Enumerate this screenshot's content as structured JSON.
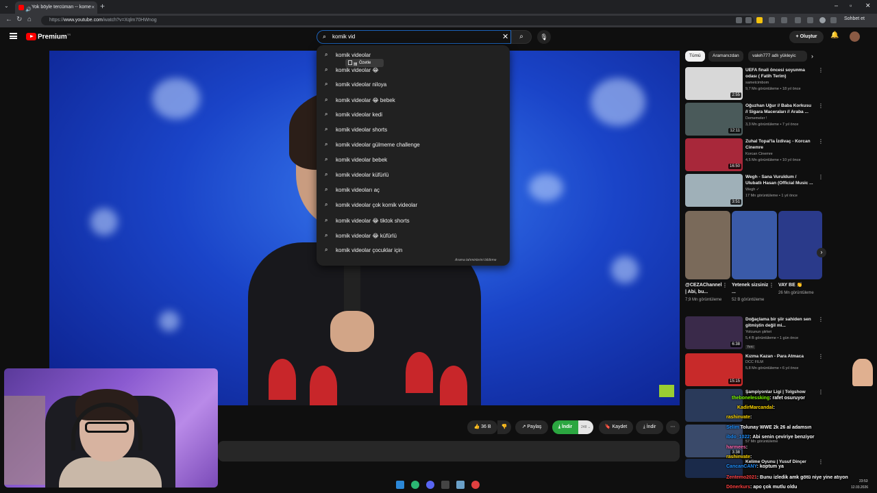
{
  "browser": {
    "tab_title": "Yok böyle tercüman -- kome",
    "url_prefix": "https://",
    "url_domain": "www.youtube.com",
    "url_path": "/watch?v=Xqlm70HWnog",
    "chat_button": "Sohbet et"
  },
  "youtube": {
    "logo_text": "Premium",
    "logo_sup": "TR",
    "search_value": "komik vid",
    "create_label": "Oluştur"
  },
  "suggestions": {
    "items": [
      "komik videolar",
      "komik videolar 😂",
      "komik videolar niloya",
      "komik videolar 😂 bebek",
      "komik videolar kedi",
      "komik videolar shorts",
      "komik videolar gülmeme challenge",
      "komik videolar bebek",
      "komik videolar küfürlü",
      "komik videoları aç",
      "komik videolar çok komik videolar",
      "komik videolar 😂 tiktok shorts",
      "komik videolar 😂 küfürlü",
      "komik videolar çocuklar için"
    ],
    "summarize_label": "Özetle",
    "footer": "Arama tahminlerini bildirme"
  },
  "actions": {
    "likes": "36 B",
    "share": "Paylaş",
    "join": "İndir",
    "join_count": "248",
    "save": "Kaydet",
    "download": "İndir"
  },
  "filters": [
    "Tümü",
    "Aramanızdan",
    "valeh777 adlı yükleyic"
  ],
  "related": [
    {
      "title": "UEFA finali öncesi soyunma odası ( Fatih Terim)",
      "channel": "sametcimbom",
      "meta": "9,7 Mn görüntüleme • 18 yıl önce",
      "duration": "2:55",
      "color": "#c8c8c8"
    },
    {
      "title": "Oğuzhan Uğur // Baba Korkusu // Sigara Maceraları // Araba ...",
      "channel": "Dememeler !",
      "meta": "3,3 Mn görüntüleme • 7 yıl önce",
      "duration": "12:11",
      "color": "#4a5a5a"
    },
    {
      "title": "Zuhal Topal'la İzdivaç - Korcan Cinemre",
      "channel": "Korcan Cinemre",
      "meta": "4,5 Mn görüntüleme • 10 yıl önce",
      "duration": "16:50",
      "color": "#a8283a"
    },
    {
      "title": "Wegh - Sana Vuruldum / Ulubatlı Hasan (Official Music ...",
      "channel": "Wegh ✓",
      "meta": "17 Mn görüntüleme • 1 yıl önce",
      "duration": "3:51",
      "color": "#9fb0b8"
    },
    {
      "title": "Doğaçlama bir şiir sahiden sen gitmiştin değil mi...",
      "channel": "Yolcunun şiirleri",
      "meta": "5,4 B görüntüleme • 1 gün önce",
      "duration": "6:38",
      "color": "#3a2a4a",
      "badge": "Yeni"
    },
    {
      "title": "Kızma Kazan - Para Atmaca",
      "channel": "DCC FILM",
      "meta": "5,8 Mn görüntüleme • 6 yıl önce",
      "duration": "15:15",
      "color": "#c82a2a"
    },
    {
      "title": "Şampiyonlar Ligi | Tolgshow",
      "channel": "",
      "meta": "",
      "duration": "",
      "color": "#2a3a5a"
    },
    {
      "title": "",
      "channel": "",
      "meta": "57 Mn görüntüleme",
      "duration": "3:38",
      "color": "#3a4a6a"
    },
    {
      "title": "Kelime Oyunu | Yusuf Dinçer",
      "channel": "",
      "meta": "",
      "duration": "",
      "color": "#1a2a4a"
    }
  ],
  "shorts": [
    {
      "title": "@CEZAChannel | Abi, bu...",
      "meta": "7,9 Mn görüntüleme",
      "color": "#7a6a5a"
    },
    {
      "title": "Yetenek sizsiniz ...",
      "meta": "52 B görüntüleme",
      "color": "#3a5aa8"
    },
    {
      "title": "VAY BE 👏",
      "meta": "26 Mn görüntüleme",
      "color": "#2a3a8a"
    }
  ],
  "chat": [
    {
      "user": "thebonelessking",
      "msg": ": rafet osuruyor"
    },
    {
      "user": "KadirMarcandal",
      "msg": ":"
    },
    {
      "user": "rashinvate",
      "msg": ":"
    },
    {
      "user": "Selim",
      "msg": "Tolunay WWE 2k 26 al adamsın"
    },
    {
      "user": "ibdo_1022",
      "msg": ": Abi senin çeviriye benziyor"
    },
    {
      "user": "harmees",
      "msg": ":"
    },
    {
      "user": "rashinvate",
      "msg": ":"
    },
    {
      "user": "CancanCANY",
      "msg": ": koptum ya"
    },
    {
      "user": "Zentemo2021",
      "msg": ": Bunu izledik amk götü niye yine atıyon"
    },
    {
      "user": "Dönerkurs",
      "msg": ": apo çok mutlu oldu"
    }
  ],
  "taskbar": {
    "time": "23:53",
    "date": "12.03.2026"
  },
  "colors": {
    "yt_red": "#ff0000",
    "search_border": "#1c62b9",
    "join_green": "#2ba640"
  }
}
